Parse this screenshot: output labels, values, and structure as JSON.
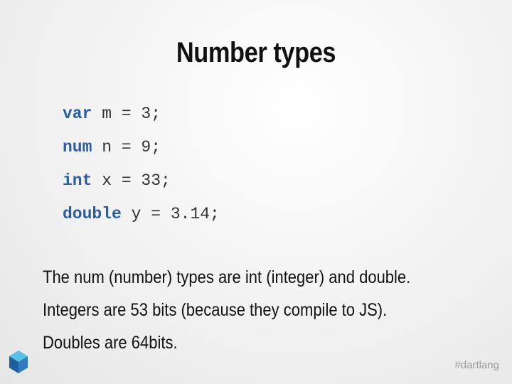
{
  "slide": {
    "title": "Number types",
    "code_lines": [
      {
        "keyword": "var",
        "rest": " m = 3;"
      },
      {
        "keyword": "num",
        "rest": " n = 9;"
      },
      {
        "keyword": "int",
        "rest": " x = 33;"
      },
      {
        "keyword": "double",
        "rest": " y = 3.14;"
      }
    ],
    "body_lines": [
      "The num (number) types are int (integer) and double.",
      "Integers are 53 bits (because they compile to JS).",
      "Doubles are 64bits."
    ],
    "hashtag": "#dartlang",
    "logo_icon": "dart-logo-icon"
  },
  "colors": {
    "keyword": "#2b5ca8",
    "logo_primary": "#2f7bbd",
    "logo_light": "#59c1e8"
  }
}
